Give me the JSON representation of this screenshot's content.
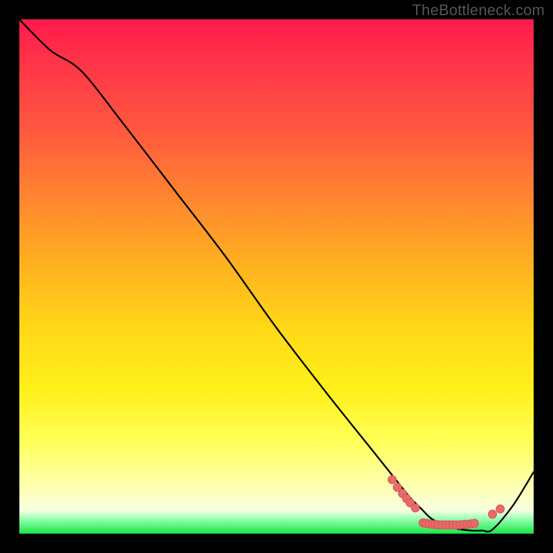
{
  "watermark": "TheBottleneck.com",
  "colors": {
    "frame_bg": "#000000",
    "curve_stroke": "#000000",
    "marker_fill": "#e86a6a",
    "marker_stroke": "#d65454",
    "gradient_top": "#ff1a4b",
    "gradient_bottom": "#17e646"
  },
  "chart_data": {
    "type": "line",
    "title": "",
    "xlabel": "",
    "ylabel": "",
    "xlim": [
      0,
      100
    ],
    "ylim": [
      0,
      100
    ],
    "grid": false,
    "annotations": [
      "TheBottleneck.com"
    ],
    "series": [
      {
        "name": "curve",
        "x": [
          0,
          6,
          12,
          20,
          30,
          40,
          50,
          60,
          68,
          72,
          76,
          78,
          80,
          82,
          84,
          86,
          88,
          90,
          92,
          96,
          100
        ],
        "y": [
          100,
          94,
          90,
          80,
          67,
          54,
          40,
          27,
          17,
          12,
          7,
          5,
          3,
          2,
          1.2,
          0.8,
          0.6,
          0.6,
          0.8,
          5.5,
          12
        ]
      }
    ],
    "markers": [
      {
        "x": 72.5,
        "y": 10.5
      },
      {
        "x": 73.5,
        "y": 9.0
      },
      {
        "x": 74.5,
        "y": 7.8
      },
      {
        "x": 75.3,
        "y": 6.8
      },
      {
        "x": 76.0,
        "y": 6.0
      },
      {
        "x": 77.0,
        "y": 5.0
      },
      {
        "x": 78.5,
        "y": 2.1
      },
      {
        "x": 79.1,
        "y": 2.0
      },
      {
        "x": 79.7,
        "y": 1.9
      },
      {
        "x": 80.3,
        "y": 1.8
      },
      {
        "x": 80.9,
        "y": 1.8
      },
      {
        "x": 81.5,
        "y": 1.7
      },
      {
        "x": 82.2,
        "y": 1.7
      },
      {
        "x": 82.9,
        "y": 1.7
      },
      {
        "x": 83.6,
        "y": 1.7
      },
      {
        "x": 84.3,
        "y": 1.7
      },
      {
        "x": 85.0,
        "y": 1.7
      },
      {
        "x": 85.7,
        "y": 1.7
      },
      {
        "x": 86.4,
        "y": 1.8
      },
      {
        "x": 87.1,
        "y": 1.8
      },
      {
        "x": 87.8,
        "y": 1.9
      },
      {
        "x": 88.5,
        "y": 2.0
      },
      {
        "x": 92.0,
        "y": 3.8
      },
      {
        "x": 93.5,
        "y": 4.8
      }
    ],
    "marker_radius": 6
  }
}
